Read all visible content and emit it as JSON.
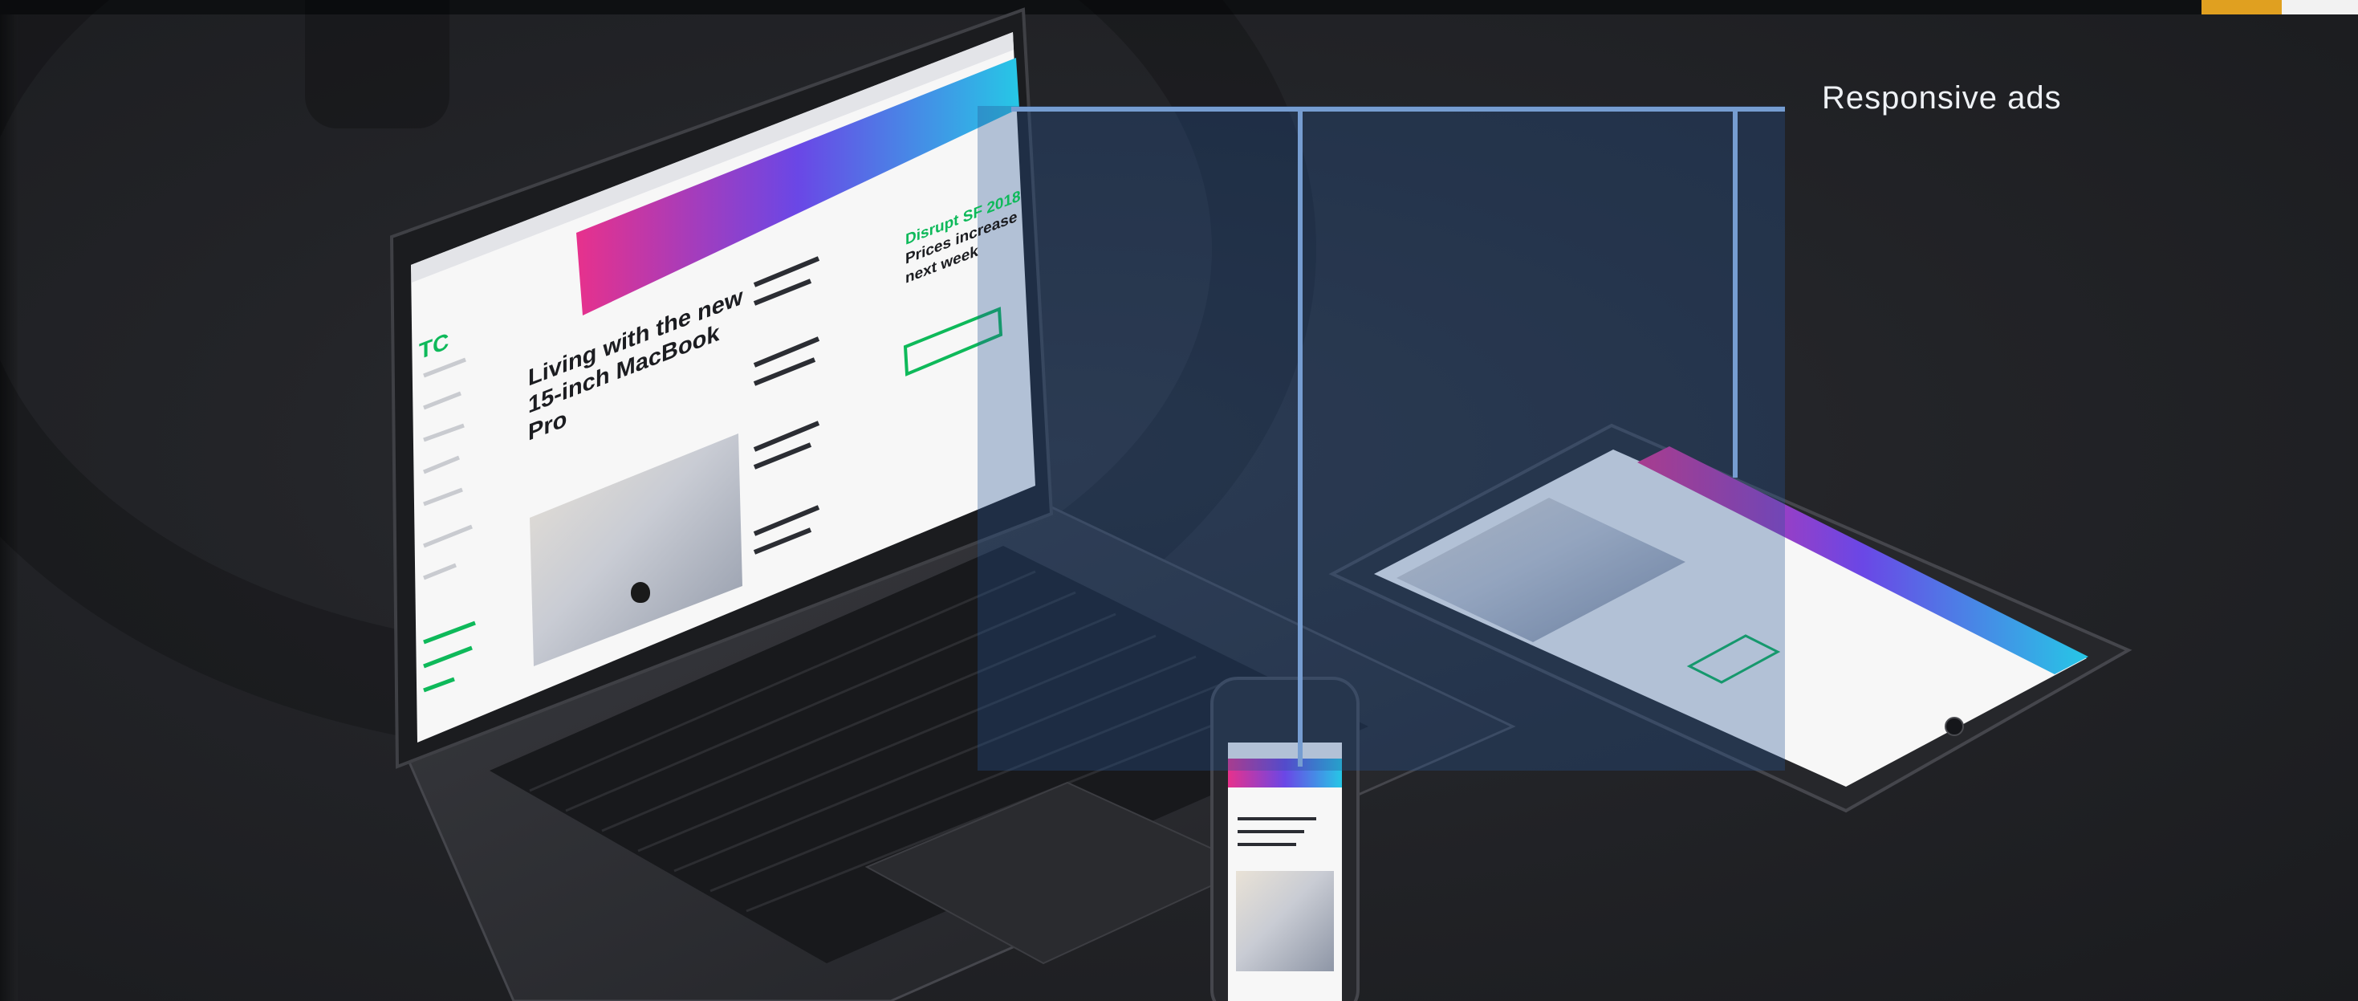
{
  "callout": {
    "label": "Responsive ads"
  },
  "screen": {
    "ad_banner_lines": [
      "",
      "",
      ""
    ],
    "sidebar_text": "",
    "headline": "Living with the new 15-inch MacBook Pro",
    "promo_title": "Disrupt SF 2018",
    "promo_subtitle": "Prices increase next week"
  },
  "colors": {
    "accent_line": "#9dc0ef",
    "ad_gradient_start": "#e7318c",
    "ad_gradient_mid": "#6a47e6",
    "ad_gradient_end": "#26c7e6",
    "brand_green": "#0eb95a",
    "device_body": "#2b2c30"
  },
  "icons": [
    "techcrunch-logo-icon",
    "apple-logo-icon"
  ]
}
